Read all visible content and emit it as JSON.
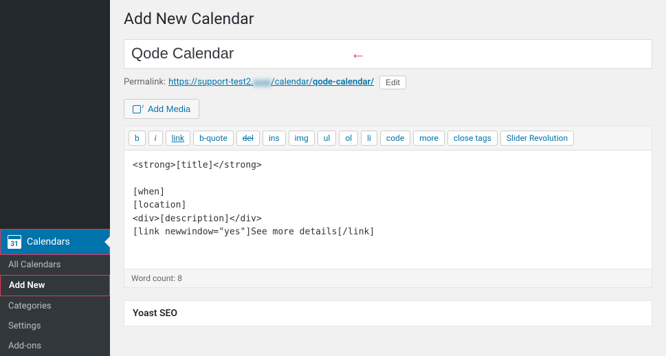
{
  "sidebar": {
    "main": {
      "label": "Calendars",
      "icon_day": "31"
    },
    "items": [
      {
        "label": "All Calendars",
        "current": false
      },
      {
        "label": "Add New",
        "current": true
      },
      {
        "label": "Categories",
        "current": false
      },
      {
        "label": "Settings",
        "current": false
      },
      {
        "label": "Add-ons",
        "current": false
      }
    ]
  },
  "page": {
    "heading": "Add New Calendar",
    "title_value": "Qode Calendar"
  },
  "permalink": {
    "label": "Permalink:",
    "url_prefix": "https://support-test2.",
    "url_hidden": "xxxx",
    "url_mid": "/calendar/",
    "url_slug": "qode-calendar/",
    "edit_label": "Edit"
  },
  "media": {
    "label": "Add Media"
  },
  "quicktags": [
    {
      "label": "b",
      "cls": ""
    },
    {
      "label": "i",
      "cls": "i"
    },
    {
      "label": "link",
      "cls": "u"
    },
    {
      "label": "b-quote",
      "cls": ""
    },
    {
      "label": "del",
      "cls": "s"
    },
    {
      "label": "ins",
      "cls": ""
    },
    {
      "label": "img",
      "cls": ""
    },
    {
      "label": "ul",
      "cls": ""
    },
    {
      "label": "ol",
      "cls": ""
    },
    {
      "label": "li",
      "cls": ""
    },
    {
      "label": "code",
      "cls": ""
    },
    {
      "label": "more",
      "cls": ""
    },
    {
      "label": "close tags",
      "cls": ""
    },
    {
      "label": "Slider Revolution",
      "cls": ""
    }
  ],
  "editor": {
    "content": "<strong>[title]</strong>\n\n[when]\n[location]\n<div>[description]</div>\n[link newwindow=\"yes\"]See more details[/link]"
  },
  "wordcount": {
    "label": "Word count:",
    "value": "8"
  },
  "metabox": {
    "title": "Yoast SEO"
  }
}
